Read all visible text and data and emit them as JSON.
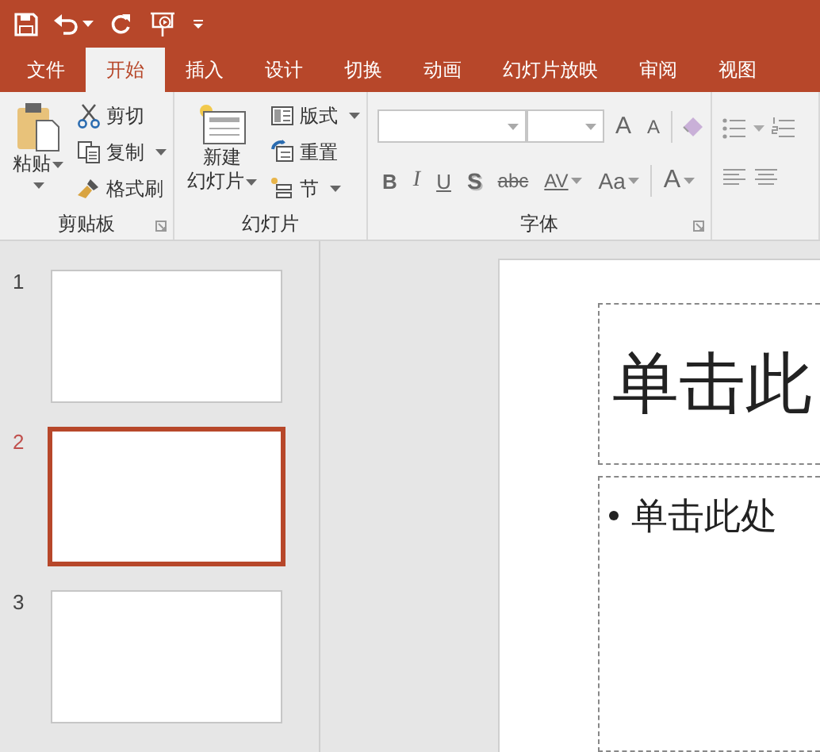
{
  "tabs": [
    {
      "label": "文件",
      "selected": false
    },
    {
      "label": "开始",
      "selected": true
    },
    {
      "label": "插入",
      "selected": false
    },
    {
      "label": "设计",
      "selected": false
    },
    {
      "label": "切换",
      "selected": false
    },
    {
      "label": "动画",
      "selected": false
    },
    {
      "label": "幻灯片放映",
      "selected": false
    },
    {
      "label": "审阅",
      "selected": false
    },
    {
      "label": "视图",
      "selected": false
    }
  ],
  "ribbon": {
    "groups": [
      {
        "kind": "clipboard",
        "label": "剪贴板",
        "big_button": [
          "粘贴"
        ],
        "commands": [
          {
            "kind": "cut",
            "label": "剪切",
            "dropdown": false
          },
          {
            "kind": "copy",
            "label": "复制",
            "dropdown": true
          },
          {
            "kind": "painter",
            "label": "格式刷",
            "dropdown": false
          }
        ]
      },
      {
        "kind": "slides",
        "label": "幻灯片",
        "big_button": [
          "新建",
          "幻灯片"
        ],
        "commands": [
          {
            "kind": "layout",
            "label": "版式",
            "dropdown": true
          },
          {
            "kind": "reset",
            "label": "重置",
            "dropdown": false
          },
          {
            "kind": "section",
            "label": "节",
            "dropdown": true
          }
        ]
      },
      {
        "kind": "font",
        "label": "字体",
        "size_buttons": [
          "A",
          "A"
        ],
        "format_buttons": [
          {
            "kind": "bold",
            "label": "B"
          },
          {
            "kind": "italic",
            "label": "I"
          },
          {
            "kind": "underline",
            "label": "U"
          },
          {
            "kind": "shadow",
            "label": "S"
          },
          {
            "kind": "strike",
            "label": "abc"
          },
          {
            "kind": "spacing",
            "label": "AV"
          },
          {
            "kind": "case",
            "label": "Aa"
          }
        ],
        "color_button": "A"
      },
      {
        "kind": "paragraph"
      }
    ]
  },
  "slides": [
    {
      "number": "1",
      "selected": false
    },
    {
      "number": "2",
      "selected": true
    },
    {
      "number": "3",
      "selected": false
    }
  ],
  "editor": {
    "title_placeholder": "单击此",
    "body_placeholder": "单击此处"
  }
}
